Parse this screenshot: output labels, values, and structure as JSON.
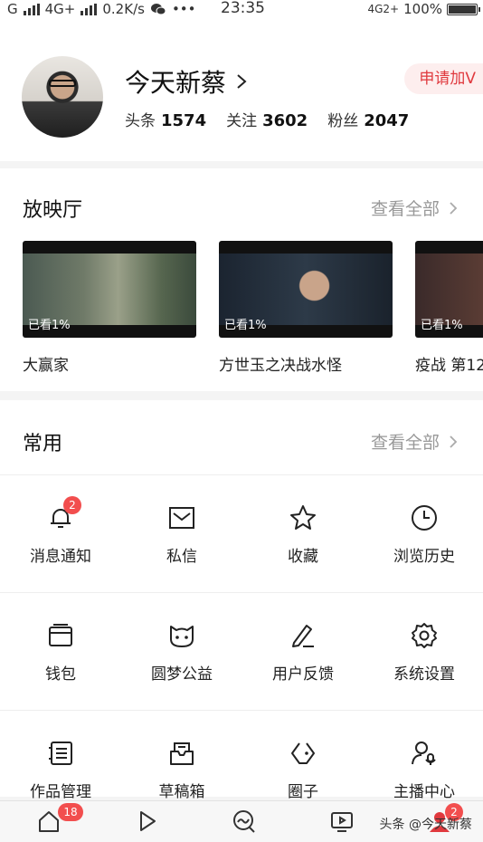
{
  "status_bar": {
    "carrier": "G",
    "network": "4G+",
    "speed": "0.2K/s",
    "more": "•••",
    "time": "23:35",
    "network_right": "4G2+",
    "battery": "100%"
  },
  "profile": {
    "name": "今天新蔡",
    "apply_v": "申请加V",
    "stats": [
      {
        "label": "头条",
        "value": "1574"
      },
      {
        "label": "关注",
        "value": "3602"
      },
      {
        "label": "粉丝",
        "value": "2047"
      }
    ]
  },
  "theater": {
    "title": "放映厅",
    "see_all": "查看全部",
    "items": [
      {
        "title": "大赢家",
        "progress": "已看1%"
      },
      {
        "title": "方世玉之决战水怪",
        "progress": "已看1%"
      },
      {
        "title": "疫战 第12",
        "progress": "已看1%"
      }
    ]
  },
  "common": {
    "title": "常用",
    "see_all": "查看全部",
    "items": [
      {
        "label": "消息通知",
        "icon": "bell-icon",
        "badge": "2"
      },
      {
        "label": "私信",
        "icon": "mail-icon"
      },
      {
        "label": "收藏",
        "icon": "star-icon"
      },
      {
        "label": "浏览历史",
        "icon": "clock-icon"
      },
      {
        "label": "钱包",
        "icon": "wallet-icon"
      },
      {
        "label": "圆梦公益",
        "icon": "charity-face-icon"
      },
      {
        "label": "用户反馈",
        "icon": "pen-icon"
      },
      {
        "label": "系统设置",
        "icon": "gear-icon"
      },
      {
        "label": "作品管理",
        "icon": "document-icon"
      },
      {
        "label": "草稿箱",
        "icon": "drafts-icon"
      },
      {
        "label": "圈子",
        "icon": "circle-icon"
      },
      {
        "label": "主播中心",
        "icon": "anchor-icon"
      }
    ]
  },
  "tabbar": {
    "home_badge": "18",
    "me_badge": "2",
    "watermark": "头条 @今天新蔡"
  },
  "colors": {
    "accent_red": "#e0393e",
    "badge_red": "#f24e4e"
  }
}
